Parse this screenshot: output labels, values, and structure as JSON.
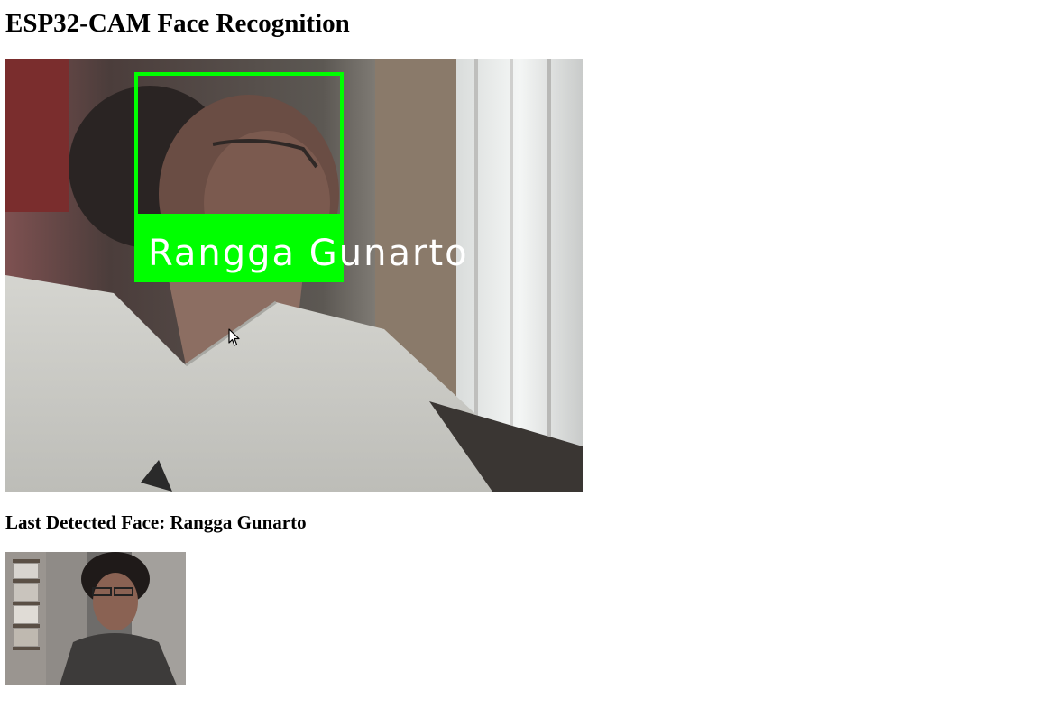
{
  "page": {
    "title": "ESP32-CAM Face Recognition"
  },
  "stream": {
    "detected_name": "Rangga Gunarto",
    "box_color": "#00ff00",
    "label_color": "#ffffff"
  },
  "last_detected": {
    "label": "Last Detected Face: Rangga Gunarto"
  },
  "icons": {
    "cursor": "mouse-pointer-icon"
  }
}
